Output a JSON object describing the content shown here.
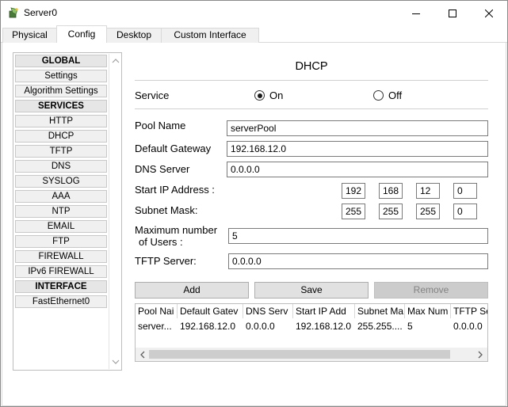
{
  "window": {
    "title": "Server0"
  },
  "tabs": [
    "Physical",
    "Config",
    "Desktop",
    "Custom Interface"
  ],
  "sidebar": {
    "items": [
      {
        "label": "GLOBAL",
        "header": true
      },
      {
        "label": "Settings",
        "header": false
      },
      {
        "label": "Algorithm Settings",
        "header": false
      },
      {
        "label": "SERVICES",
        "header": true
      },
      {
        "label": "HTTP",
        "header": false
      },
      {
        "label": "DHCP",
        "header": false
      },
      {
        "label": "TFTP",
        "header": false
      },
      {
        "label": "DNS",
        "header": false
      },
      {
        "label": "SYSLOG",
        "header": false
      },
      {
        "label": "AAA",
        "header": false
      },
      {
        "label": "NTP",
        "header": false
      },
      {
        "label": "EMAIL",
        "header": false
      },
      {
        "label": "FTP",
        "header": false
      },
      {
        "label": "FIREWALL",
        "header": false
      },
      {
        "label": "IPv6 FIREWALL",
        "header": false
      },
      {
        "label": "INTERFACE",
        "header": true
      },
      {
        "label": "FastEthernet0",
        "header": false
      }
    ]
  },
  "dhcp": {
    "title": "DHCP",
    "service_label": "Service",
    "on_label": "On",
    "off_label": "Off",
    "service_on": true,
    "pool_name_label": "Pool Name",
    "pool_name": "serverPool",
    "gateway_label": "Default Gateway",
    "gateway": "192.168.12.0",
    "dns_label": "DNS Server",
    "dns": "0.0.0.0",
    "start_ip_label": "Start IP Address :",
    "start_ip": [
      "192",
      "168",
      "12",
      "0"
    ],
    "subnet_label": "Subnet Mask:",
    "subnet": [
      "255",
      "255",
      "255",
      "0"
    ],
    "max_users_label_1": "Maximum number",
    "max_users_label_2": "of Users :",
    "max_users": "5",
    "tftp_label": "TFTP Server:",
    "tftp": "0.0.0.0",
    "add_label": "Add",
    "save_label": "Save",
    "remove_label": "Remove"
  },
  "table": {
    "headers": [
      "Pool Nai",
      "Default Gatev",
      "DNS Serv",
      "Start IP Add",
      "Subnet Ma",
      "Max Num",
      "TFTP Se"
    ],
    "rows": [
      [
        "server...",
        "192.168.12.0",
        "0.0.0.0",
        "192.168.12.0",
        "255.255....",
        "5",
        "0.0.0.0"
      ]
    ]
  }
}
